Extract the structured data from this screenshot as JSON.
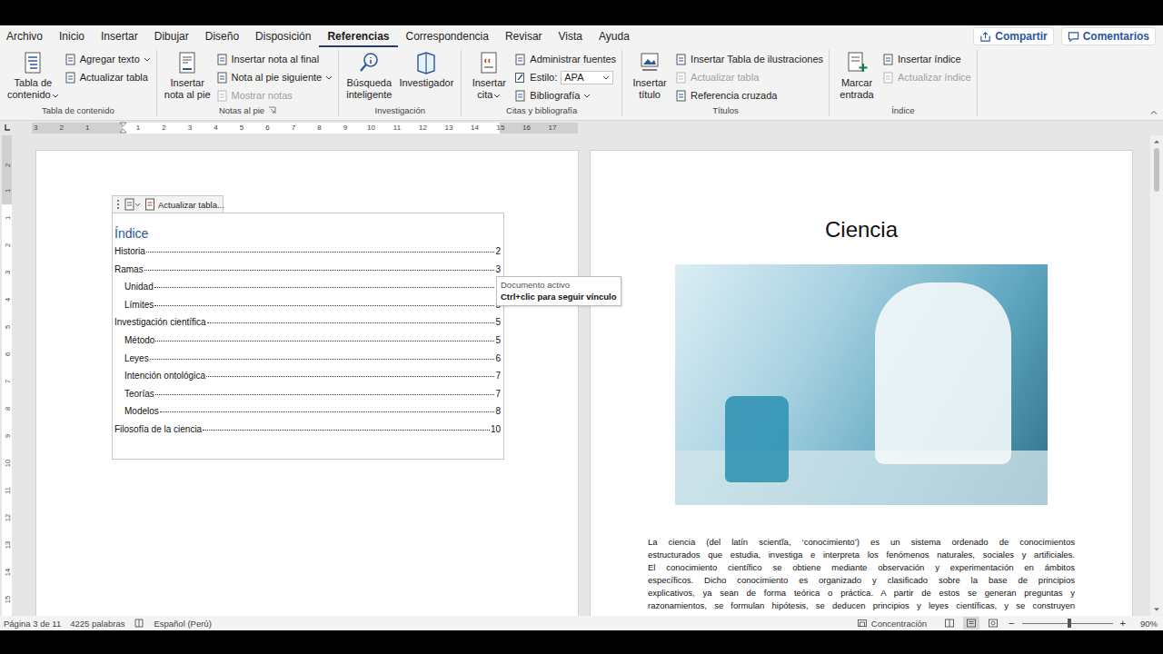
{
  "menu_tabs": [
    {
      "label": "Archivo",
      "selected": false
    },
    {
      "label": "Inicio",
      "selected": false
    },
    {
      "label": "Insertar",
      "selected": false
    },
    {
      "label": "Dibujar",
      "selected": false
    },
    {
      "label": "Diseño",
      "selected": false
    },
    {
      "label": "Disposición",
      "selected": false
    },
    {
      "label": "Referencias",
      "selected": true
    },
    {
      "label": "Correspondencia",
      "selected": false
    },
    {
      "label": "Revisar",
      "selected": false
    },
    {
      "label": "Vista",
      "selected": false
    },
    {
      "label": "Ayuda",
      "selected": false
    }
  ],
  "share": {
    "label": "Compartir"
  },
  "comments": {
    "label": "Comentarios"
  },
  "ribbon_groups": [
    {
      "label": "Tabla de contenido",
      "launcher": false,
      "big": [
        {
          "lines": [
            "Tabla de",
            "contenido"
          ],
          "dropdown": true,
          "disabled": false
        }
      ],
      "small": [
        {
          "kind": "button",
          "label": "Agregar texto",
          "dropdown": true,
          "disabled": false
        },
        {
          "kind": "button",
          "label": "Actualizar tabla",
          "dropdown": false,
          "disabled": false
        }
      ]
    },
    {
      "label": "Notas al pie",
      "launcher": true,
      "big": [
        {
          "lines": [
            "Insertar",
            "nota al pie"
          ],
          "dropdown": false,
          "disabled": false
        }
      ],
      "small": [
        {
          "kind": "button",
          "label": "Insertar nota al final",
          "dropdown": false,
          "disabled": false
        },
        {
          "kind": "button",
          "label": "Nota al pie siguiente",
          "dropdown": true,
          "disabled": false
        },
        {
          "kind": "button",
          "label": "Mostrar notas",
          "dropdown": false,
          "disabled": true
        }
      ]
    },
    {
      "label": "Investigación",
      "launcher": false,
      "big": [
        {
          "lines": [
            "Búsqueda",
            "inteligente"
          ],
          "dropdown": false,
          "disabled": false
        },
        {
          "lines": [
            "Investigador"
          ],
          "dropdown": false,
          "disabled": false
        }
      ],
      "small": []
    },
    {
      "label": "Citas y bibliografía",
      "launcher": false,
      "big": [
        {
          "lines": [
            "Insertar",
            "cita"
          ],
          "dropdown": true,
          "disabled": false
        }
      ],
      "small": [
        {
          "kind": "button",
          "label": "Administrar fuentes",
          "dropdown": false,
          "disabled": false
        },
        {
          "kind": "select",
          "label": "Estilo:",
          "value": "APA",
          "dropdown": true,
          "disabled": false
        },
        {
          "kind": "button",
          "label": "Bibliografía",
          "dropdown": true,
          "disabled": false
        }
      ]
    },
    {
      "label": "Títulos",
      "launcher": false,
      "big": [
        {
          "lines": [
            "Insertar",
            "título"
          ],
          "dropdown": false,
          "disabled": false
        }
      ],
      "small": [
        {
          "kind": "button",
          "label": "Insertar Tabla de ilustraciones",
          "dropdown": false,
          "disabled": false
        },
        {
          "kind": "button",
          "label": "Actualizar tabla",
          "dropdown": false,
          "disabled": true
        },
        {
          "kind": "button",
          "label": "Referencia cruzada",
          "dropdown": false,
          "disabled": false
        }
      ]
    },
    {
      "label": "Índice",
      "launcher": false,
      "big": [
        {
          "lines": [
            "Marcar",
            "entrada"
          ],
          "dropdown": false,
          "disabled": false
        }
      ],
      "small": [
        {
          "kind": "button",
          "label": "Insertar índice",
          "dropdown": false,
          "disabled": false
        },
        {
          "kind": "button",
          "label": "Actualizar índice",
          "dropdown": false,
          "disabled": true
        }
      ]
    }
  ],
  "ruler": {
    "margin": [
      "3",
      "2",
      "1"
    ],
    "body": [
      "1",
      "2",
      "3",
      "4",
      "5",
      "6",
      "7",
      "8",
      "9",
      "10",
      "11",
      "12",
      "13",
      "14",
      "15",
      "16",
      "17"
    ]
  },
  "vertical_ruler": {
    "margin": [
      "2",
      "1"
    ],
    "body": [
      "1",
      "2",
      "3",
      "4",
      "5",
      "6",
      "7",
      "8",
      "9",
      "10",
      "11",
      "12",
      "13",
      "14",
      "15"
    ]
  },
  "toc_toolbar": {
    "button": "Actualizar tabla..."
  },
  "toc": {
    "title": "Índice",
    "entries": [
      {
        "label": "Historia",
        "page": "2",
        "level": 1
      },
      {
        "label": "Ramas",
        "page": "3",
        "level": 1
      },
      {
        "label": "Unidad",
        "page": "",
        "level": 2
      },
      {
        "label": "Límites",
        "page": "5",
        "level": 2
      },
      {
        "label": "Investigación científica",
        "page": "5",
        "level": 1
      },
      {
        "label": "Método",
        "page": "5",
        "level": 2
      },
      {
        "label": "Leyes",
        "page": "6",
        "level": 2
      },
      {
        "label": "Intención ontológica",
        "page": "7",
        "level": 2
      },
      {
        "label": "Teorías",
        "page": "7",
        "level": 2
      },
      {
        "label": "Modelos",
        "page": "8",
        "level": 2
      },
      {
        "label": "Filosofía de la ciencia",
        "page": "10",
        "level": 1
      }
    ]
  },
  "tooltip": {
    "title": "Documento activo",
    "hint": "Ctrl+clic para seguir vínculo"
  },
  "right_page": {
    "title": "Ciencia",
    "paragraph_lines": [
      "La ciencia (del latín scientĭa, ‘conocimiento’) es un sistema ordenado de conocimientos",
      "estructurados que estudia, investiga e interpreta los fenómenos naturales, sociales y artificiales.",
      "El conocimiento científico se obtiene mediante observación y experimentación en ámbitos",
      "específicos. Dicho conocimiento es organizado y clasificado sobre la base de principios",
      "explicativos, ya sean de forma teórica o práctica. A partir de estos se generan preguntas y",
      "razonamientos, se formulan hipótesis, se deducen principios y leyes científicas, y se construyen"
    ]
  },
  "status_bar": {
    "page": "Página 3 de 11",
    "words": "4225 palabras",
    "language": "Español (Perú)",
    "focus": "Concentración",
    "views": [
      {
        "selected": false
      },
      {
        "selected": true
      },
      {
        "selected": false
      }
    ],
    "zoom_out": "−",
    "zoom_in": "+",
    "zoom_level": 0.52,
    "zoom": "90%"
  }
}
